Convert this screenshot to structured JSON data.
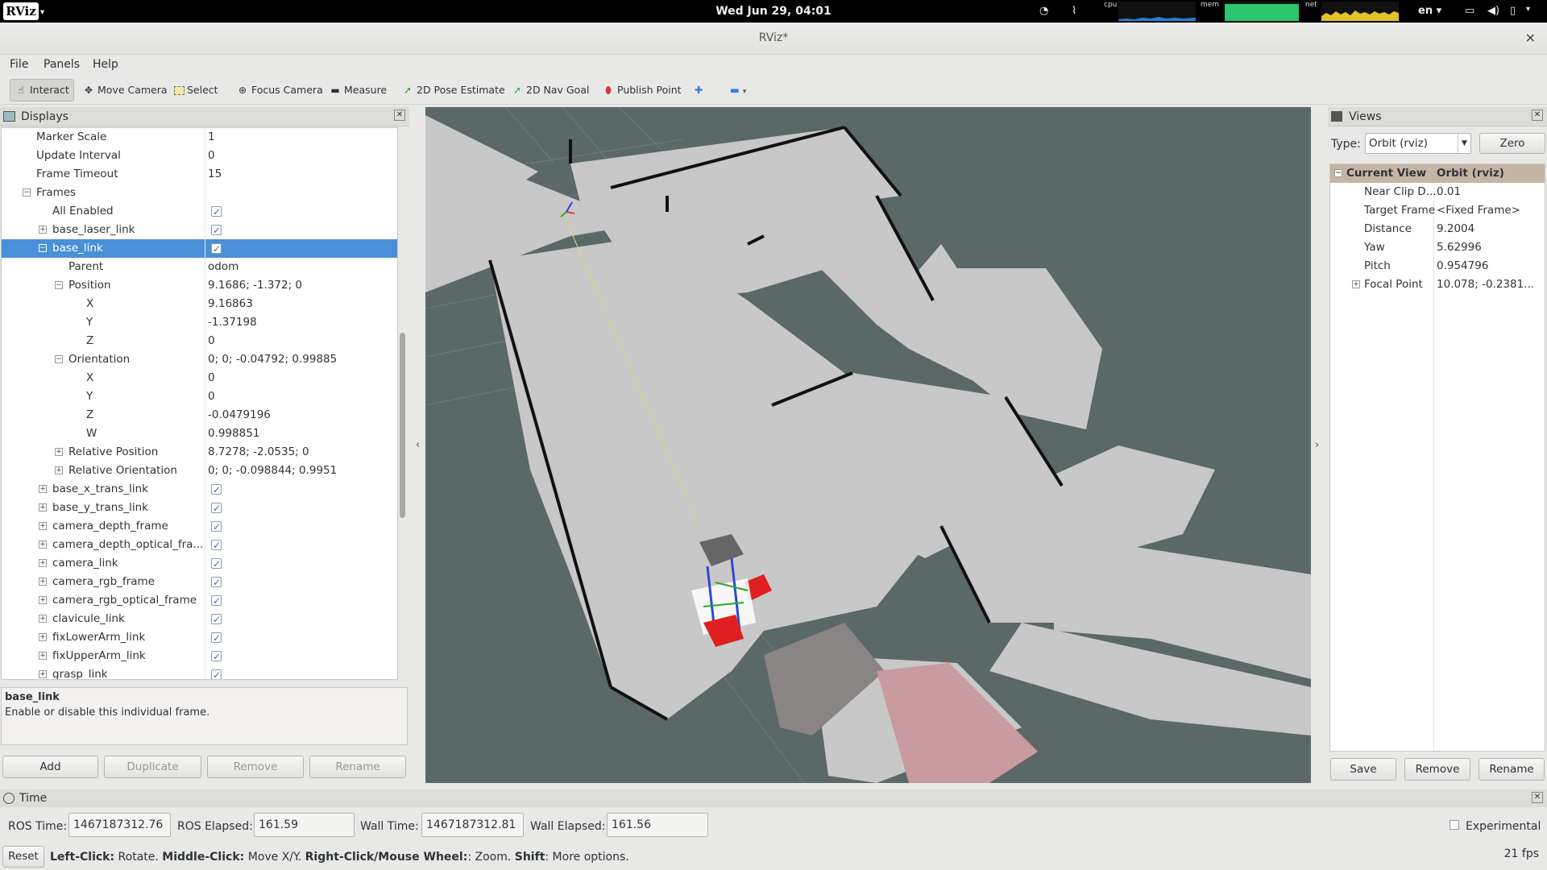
{
  "topbar": {
    "app_name": "RViz",
    "logo_text": "RViz",
    "clock": "Wed Jun 29, 04:01",
    "cpu_label": "cpu",
    "mem_label": "mem",
    "net_label": "net",
    "language": "en ▾"
  },
  "window": {
    "title": "RViz*",
    "close": "×"
  },
  "menu": {
    "file": "File",
    "panels": "Panels",
    "help": "Help"
  },
  "toolbar": {
    "interact": "Interact",
    "move_camera": "Move Camera",
    "select": "Select",
    "focus_camera": "Focus Camera",
    "measure": "Measure",
    "pose_estimate": "2D Pose Estimate",
    "nav_goal": "2D Nav Goal",
    "publish_point": "Publish Point"
  },
  "displays": {
    "title": "Displays",
    "rows": [
      {
        "name": "Marker Scale",
        "value": "1"
      },
      {
        "name": "Update Interval",
        "value": "0"
      },
      {
        "name": "Frame Timeout",
        "value": "15"
      },
      {
        "name": "Frames",
        "value": ""
      },
      {
        "name": "All Enabled",
        "value": ""
      },
      {
        "name": "base_laser_link",
        "value": ""
      },
      {
        "name": "base_link",
        "value": ""
      },
      {
        "name": "Parent",
        "value": "odom"
      },
      {
        "name": "Position",
        "value": "9.1686; -1.372; 0"
      },
      {
        "name": "X",
        "value": "9.16863"
      },
      {
        "name": "Y",
        "value": "-1.37198"
      },
      {
        "name": "Z",
        "value": "0"
      },
      {
        "name": "Orientation",
        "value": "0; 0; -0.04792; 0.99885"
      },
      {
        "name": "X",
        "value": "0"
      },
      {
        "name": "Y",
        "value": "0"
      },
      {
        "name": "Z",
        "value": "-0.0479196"
      },
      {
        "name": "W",
        "value": "0.998851"
      },
      {
        "name": "Relative Position",
        "value": "8.7278; -2.0535; 0"
      },
      {
        "name": "Relative Orientation",
        "value": "0; 0; -0.098844; 0.9951"
      },
      {
        "name": "base_x_trans_link",
        "value": ""
      },
      {
        "name": "base_y_trans_link",
        "value": ""
      },
      {
        "name": "camera_depth_frame",
        "value": ""
      },
      {
        "name": "camera_depth_optical_fra...",
        "value": ""
      },
      {
        "name": "camera_link",
        "value": ""
      },
      {
        "name": "camera_rgb_frame",
        "value": ""
      },
      {
        "name": "camera_rgb_optical_frame",
        "value": ""
      },
      {
        "name": "clavicule_link",
        "value": ""
      },
      {
        "name": "fixLowerArm_link",
        "value": ""
      },
      {
        "name": "fixUpperArm_link",
        "value": ""
      },
      {
        "name": "grasp_link",
        "value": ""
      }
    ],
    "desc_title": "base_link",
    "desc_text": "Enable or disable this individual frame.",
    "add": "Add",
    "duplicate": "Duplicate",
    "remove": "Remove",
    "rename": "Rename"
  },
  "views": {
    "title": "Views",
    "type_label": "Type:",
    "type_value": "Orbit (rviz)",
    "zero": "Zero",
    "rows": [
      {
        "name": "Current View",
        "value": "Orbit (rviz)"
      },
      {
        "name": "Near Clip D...",
        "value": "0.01"
      },
      {
        "name": "Target Frame",
        "value": "<Fixed Frame>"
      },
      {
        "name": "Distance",
        "value": "9.2004"
      },
      {
        "name": "Yaw",
        "value": "5.62996"
      },
      {
        "name": "Pitch",
        "value": "0.954796"
      },
      {
        "name": "Focal Point",
        "value": "10.078; -0.2381..."
      }
    ],
    "save": "Save",
    "remove": "Remove",
    "rename": "Rename"
  },
  "time": {
    "title": "Time",
    "ros_time_label": "ROS Time:",
    "ros_time": "1467187312.76",
    "ros_elapsed_label": "ROS Elapsed:",
    "ros_elapsed": "161.59",
    "wall_time_label": "Wall Time:",
    "wall_time": "1467187312.81",
    "wall_elapsed_label": "Wall Elapsed:",
    "wall_elapsed": "161.56",
    "experimental": "Experimental"
  },
  "status": {
    "reset": "Reset",
    "lc": "Left-Click:",
    "lc_t": " Rotate. ",
    "mc": "Middle-Click:",
    "mc_t": " Move X/Y. ",
    "rc": "Right-Click/Mouse Wheel:",
    "rc_t": ": Zoom. ",
    "sh": "Shift",
    "sh_t": ": More options.",
    "fps": "21 fps"
  }
}
